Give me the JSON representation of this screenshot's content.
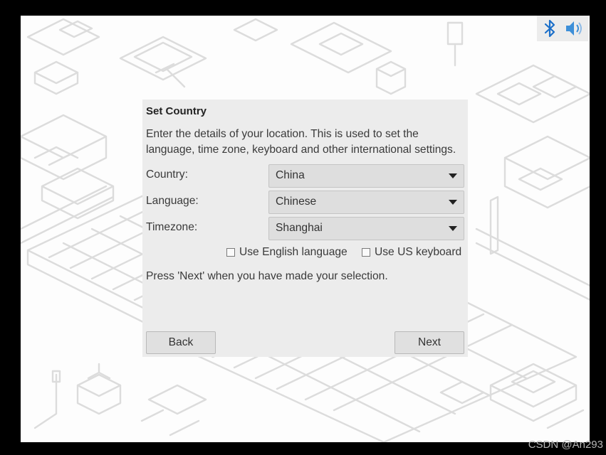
{
  "tray": {
    "icons": [
      "bluetooth-icon",
      "volume-icon"
    ],
    "bluetooth_color": "#1b6fc9",
    "volume_color": "#3d8fd8"
  },
  "dialog": {
    "title": "Set Country",
    "description": "Enter the details of your location. This is used to set the language, time zone, keyboard and other international settings.",
    "country": {
      "label": "Country:",
      "value": "China"
    },
    "language": {
      "label": "Language:",
      "value": "Chinese"
    },
    "timezone": {
      "label": "Timezone:",
      "value": "Shanghai"
    },
    "use_english": {
      "label": "Use English language",
      "checked": false
    },
    "use_us_keyboard": {
      "label": "Use US keyboard",
      "checked": false
    },
    "hint": "Press 'Next' when you have made your selection.",
    "back_label": "Back",
    "next_label": "Next"
  },
  "watermark": "CSDN @An293"
}
